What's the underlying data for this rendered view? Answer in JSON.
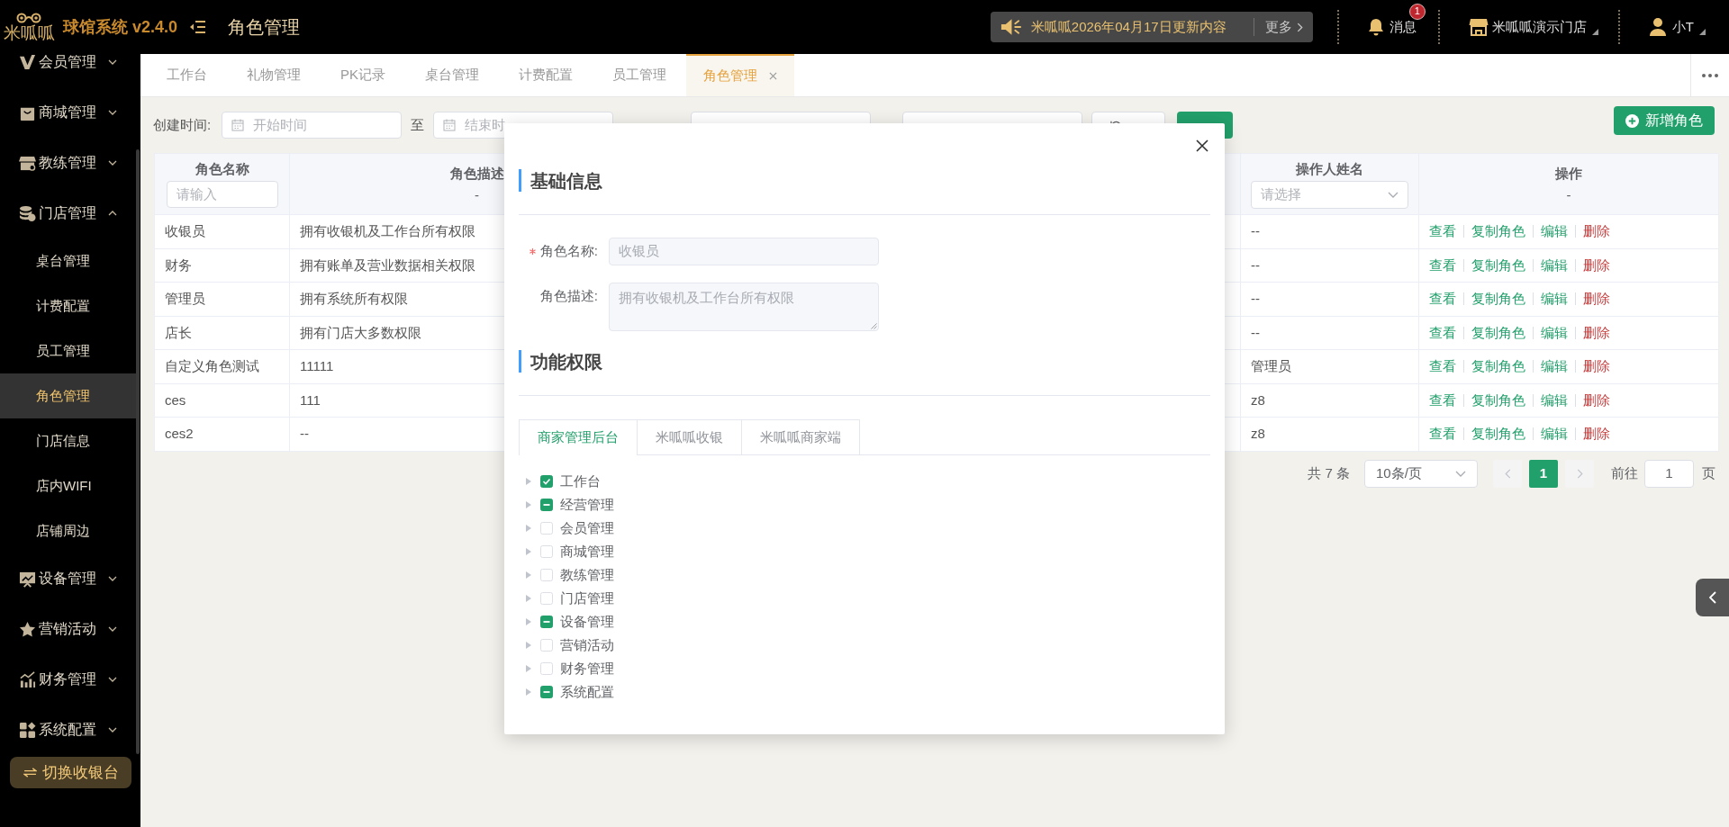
{
  "header": {
    "logo": "米呱呱",
    "app_name": "球馆系统 v2.4.0",
    "page_title": "角色管理",
    "notice": {
      "text": "米呱呱2026年04月17日更新内容",
      "more": "更多"
    },
    "messages": {
      "label": "消息",
      "badge": "1"
    },
    "store": {
      "label": "米呱呱演示门店"
    },
    "user": {
      "label": "小T"
    }
  },
  "sidebar": {
    "items": [
      {
        "label": "会员管理",
        "expanded": false
      },
      {
        "label": "商城管理",
        "expanded": false
      },
      {
        "label": "教练管理",
        "expanded": false
      },
      {
        "label": "门店管理",
        "expanded": true,
        "children": [
          {
            "label": "桌台管理",
            "selected": false
          },
          {
            "label": "计费配置",
            "selected": false
          },
          {
            "label": "员工管理",
            "selected": false
          },
          {
            "label": "角色管理",
            "selected": true
          },
          {
            "label": "门店信息",
            "selected": false
          },
          {
            "label": "店内WIFI",
            "selected": false
          },
          {
            "label": "店铺周边",
            "selected": false
          }
        ]
      },
      {
        "label": "设备管理",
        "expanded": false
      },
      {
        "label": "营销活动",
        "expanded": false
      },
      {
        "label": "财务管理",
        "expanded": false
      },
      {
        "label": "系统配置",
        "expanded": false
      }
    ],
    "switch_button": "切换收银台"
  },
  "tabs": [
    {
      "label": "工作台",
      "selected": false
    },
    {
      "label": "礼物管理",
      "selected": false
    },
    {
      "label": "PK记录",
      "selected": false
    },
    {
      "label": "桌台管理",
      "selected": false
    },
    {
      "label": "计费配置",
      "selected": false
    },
    {
      "label": "员工管理",
      "selected": false
    },
    {
      "label": "角色管理",
      "selected": true
    }
  ],
  "filters": {
    "groups": [
      {
        "kind": "date_range",
        "label": "创建时间:",
        "from": {
          "placeholder": "开始时间"
        },
        "separator": "至",
        "to": {
          "placeholder": "结束时"
        }
      },
      {
        "kind": "date_range"
      }
    ],
    "buttons": [
      {
        "kind": "refresh"
      },
      {
        "kind": "primary"
      }
    ],
    "add_button": "新增角色"
  },
  "table": {
    "columns": [
      {
        "title": "角色名称",
        "filter": {
          "kind": "input",
          "placeholder": "请输入"
        }
      },
      {
        "title": "角色描述",
        "filter": {
          "kind": "text",
          "text": "-"
        }
      },
      {
        "title": "操作人姓名",
        "filter": {
          "kind": "select",
          "placeholder": "请选择"
        }
      },
      {
        "title": "操作",
        "filter": {
          "kind": "text",
          "text": "-"
        }
      }
    ],
    "rows": [
      {
        "cells": [
          "收银员",
          "拥有收银机及工作台所有权限",
          "--"
        ],
        "actions": [
          {
            "label": "查看",
            "kind": "link"
          },
          {
            "label": "复制角色",
            "kind": "link"
          },
          {
            "label": "编辑",
            "kind": "link"
          },
          {
            "label": "删除",
            "kind": "danger"
          }
        ]
      },
      {
        "cells": [
          "财务",
          "拥有账单及营业数据相关权限",
          "--"
        ],
        "actions": [
          {
            "label": "查看",
            "kind": "link"
          },
          {
            "label": "复制角色",
            "kind": "link"
          },
          {
            "label": "编辑",
            "kind": "link"
          },
          {
            "label": "删除",
            "kind": "danger"
          }
        ]
      },
      {
        "cells": [
          "管理员",
          "拥有系统所有权限",
          "--"
        ],
        "actions": [
          {
            "label": "查看",
            "kind": "link"
          },
          {
            "label": "复制角色",
            "kind": "link"
          },
          {
            "label": "编辑",
            "kind": "link"
          },
          {
            "label": "删除",
            "kind": "danger"
          }
        ]
      },
      {
        "cells": [
          "店长",
          "拥有门店大多数权限",
          "--"
        ],
        "actions": [
          {
            "label": "查看",
            "kind": "link"
          },
          {
            "label": "复制角色",
            "kind": "link"
          },
          {
            "label": "编辑",
            "kind": "link"
          },
          {
            "label": "删除",
            "kind": "danger"
          }
        ]
      },
      {
        "cells": [
          "自定义角色测试",
          "11111",
          "管理员"
        ],
        "actions": [
          {
            "label": "查看",
            "kind": "link"
          },
          {
            "label": "复制角色",
            "kind": "link"
          },
          {
            "label": "编辑",
            "kind": "link"
          },
          {
            "label": "删除",
            "kind": "danger"
          }
        ]
      },
      {
        "cells": [
          "ces",
          "111",
          "z8"
        ],
        "actions": [
          {
            "label": "查看",
            "kind": "link"
          },
          {
            "label": "复制角色",
            "kind": "link"
          },
          {
            "label": "编辑",
            "kind": "link"
          },
          {
            "label": "删除",
            "kind": "danger"
          }
        ]
      },
      {
        "cells": [
          "ces2",
          "--",
          "z8"
        ],
        "actions": [
          {
            "label": "查看",
            "kind": "link"
          },
          {
            "label": "复制角色",
            "kind": "link"
          },
          {
            "label": "编辑",
            "kind": "link"
          },
          {
            "label": "删除",
            "kind": "danger"
          }
        ]
      }
    ]
  },
  "pagination": {
    "total": "共 7 条",
    "page_size": "10条/页",
    "pages": [
      {
        "label": "1",
        "selected": true
      }
    ],
    "goto_label": "前往",
    "goto_value": "1",
    "page_suffix": "页"
  },
  "dialog": {
    "basic_title": "基础信息",
    "fields": [
      {
        "label": "角色名称:",
        "required": true,
        "kind": "input",
        "value": "收银员",
        "disabled": true
      },
      {
        "label": "角色描述:",
        "required": false,
        "kind": "textarea",
        "value": "拥有收银机及工作台所有权限",
        "disabled": true
      }
    ],
    "permission_title": "功能权限",
    "tabs": [
      {
        "label": "商家管理后台",
        "selected": true
      },
      {
        "label": "米呱呱收银",
        "selected": false
      },
      {
        "label": "米呱呱商家端",
        "selected": false
      }
    ],
    "tree": [
      {
        "label": "工作台",
        "checked": true,
        "indeterminate": false,
        "expanded": false
      },
      {
        "label": "经营管理",
        "checked": false,
        "indeterminate": true,
        "expanded": false
      },
      {
        "label": "会员管理",
        "checked": false,
        "indeterminate": false,
        "expanded": false
      },
      {
        "label": "商城管理",
        "checked": false,
        "indeterminate": false,
        "expanded": false
      },
      {
        "label": "教练管理",
        "checked": false,
        "indeterminate": false,
        "expanded": false
      },
      {
        "label": "门店管理",
        "checked": false,
        "indeterminate": false,
        "expanded": false
      },
      {
        "label": "设备管理",
        "checked": false,
        "indeterminate": true,
        "expanded": false
      },
      {
        "label": "营销活动",
        "checked": false,
        "indeterminate": false,
        "expanded": false
      },
      {
        "label": "财务管理",
        "checked": false,
        "indeterminate": false,
        "expanded": false
      },
      {
        "label": "系统配置",
        "checked": false,
        "indeterminate": true,
        "expanded": false
      }
    ]
  }
}
